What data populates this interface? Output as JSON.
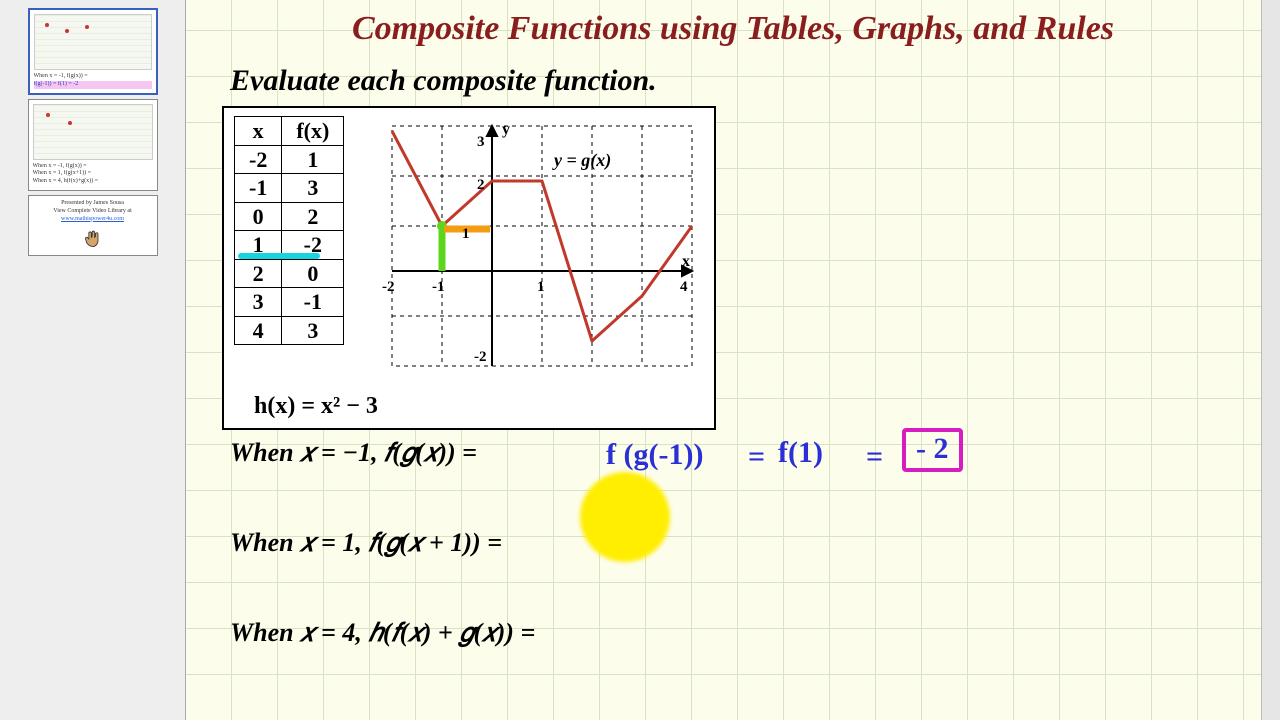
{
  "title": "Composite Functions using Tables, Graphs, and Rules",
  "subtitle": "Evaluate each composite function.",
  "table": {
    "head_x": "x",
    "head_fx": "f(x)",
    "rows": [
      {
        "x": "-2",
        "fx": "1"
      },
      {
        "x": "-1",
        "fx": "3"
      },
      {
        "x": "0",
        "fx": "2"
      },
      {
        "x": "1",
        "fx": "-2"
      },
      {
        "x": "2",
        "fx": "0"
      },
      {
        "x": "3",
        "fx": "-1"
      },
      {
        "x": "4",
        "fx": "3"
      }
    ]
  },
  "highlighted_row_index": 3,
  "h_rule": "h(x) = x²  − 3",
  "graph": {
    "label": "y = g(x)",
    "x_axis": "x",
    "y_axis": "y",
    "x_ticks": [
      "-2",
      "-1",
      "1",
      "4"
    ],
    "y_ticks": [
      "3",
      "2",
      "1",
      "-2"
    ],
    "highlight_x": -1,
    "highlight_y": 1
  },
  "problems": {
    "p1": {
      "stem": "When 𝑥 = −1, 𝑓(𝑔(𝑥)) ="
    },
    "p2": {
      "stem": "When 𝑥 = 1, 𝑓(𝑔(𝑥 + 1)) ="
    },
    "p3": {
      "stem": "When 𝑥 = 4, ℎ(𝑓(𝑥) + 𝑔(𝑥)) ="
    }
  },
  "work": {
    "step_a": "f (g(-1))",
    "eq1": "=",
    "step_b": "f(1)",
    "eq2": "=",
    "answer": "- 2"
  },
  "sidebar": {
    "s1a": "When x = -1, f(g(x)) =",
    "s1b": "f(g(-1)) = f(1) = -2",
    "s2a": "When x = -1, f(g(x)) =",
    "s2b": "When x = 1, f(g(x+1)) =",
    "s2c": "When x = 4, h(f(x)+g(x)) =",
    "s3a": "Presented by James Sousa",
    "s3b": "View Complete Video Library at",
    "s3c": "www.mathispower4u.com"
  },
  "chart_data": {
    "type": "line",
    "title": "y = g(x)",
    "xlabel": "x",
    "ylabel": "y",
    "xlim": [
      -2,
      4.5
    ],
    "ylim": [
      -2.5,
      3
    ],
    "series": [
      {
        "name": "g(x)",
        "x": [
          -2,
          -1,
          0,
          1,
          2,
          3,
          4
        ],
        "y": [
          3,
          1,
          2,
          2,
          -1.5,
          -0.5,
          1
        ]
      }
    ],
    "table_f": {
      "x": [
        -2,
        -1,
        0,
        1,
        2,
        3,
        4
      ],
      "fx": [
        1,
        3,
        2,
        -2,
        0,
        -1,
        3
      ]
    },
    "h_rule": "h(x) = x^2 - 3"
  }
}
